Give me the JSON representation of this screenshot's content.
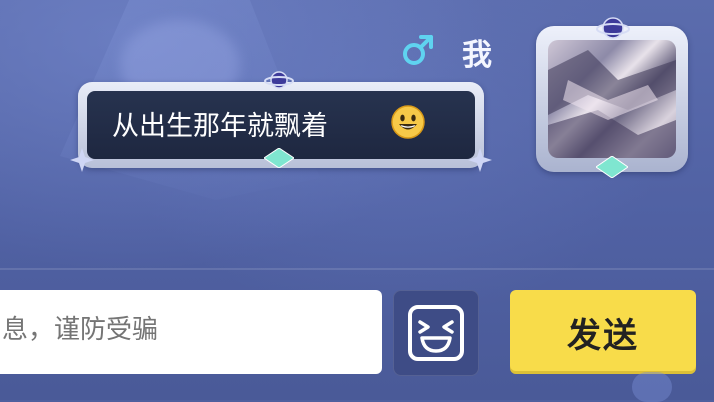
{
  "chat": {
    "sender_name": "我",
    "gender_icon": "male-icon",
    "message_text": "从出生那年就飘着",
    "message_emoji": "grinning-face-emoji"
  },
  "composer": {
    "placeholder": "息，谨防受骗",
    "emoji_button_icon": "laughing-face-icon",
    "send_label": "发送"
  },
  "colors": {
    "background": "#5061a3",
    "bubble_inner": "#27334f",
    "send_button": "#f8dc4a",
    "gender_icon": "#5fd3f0"
  }
}
